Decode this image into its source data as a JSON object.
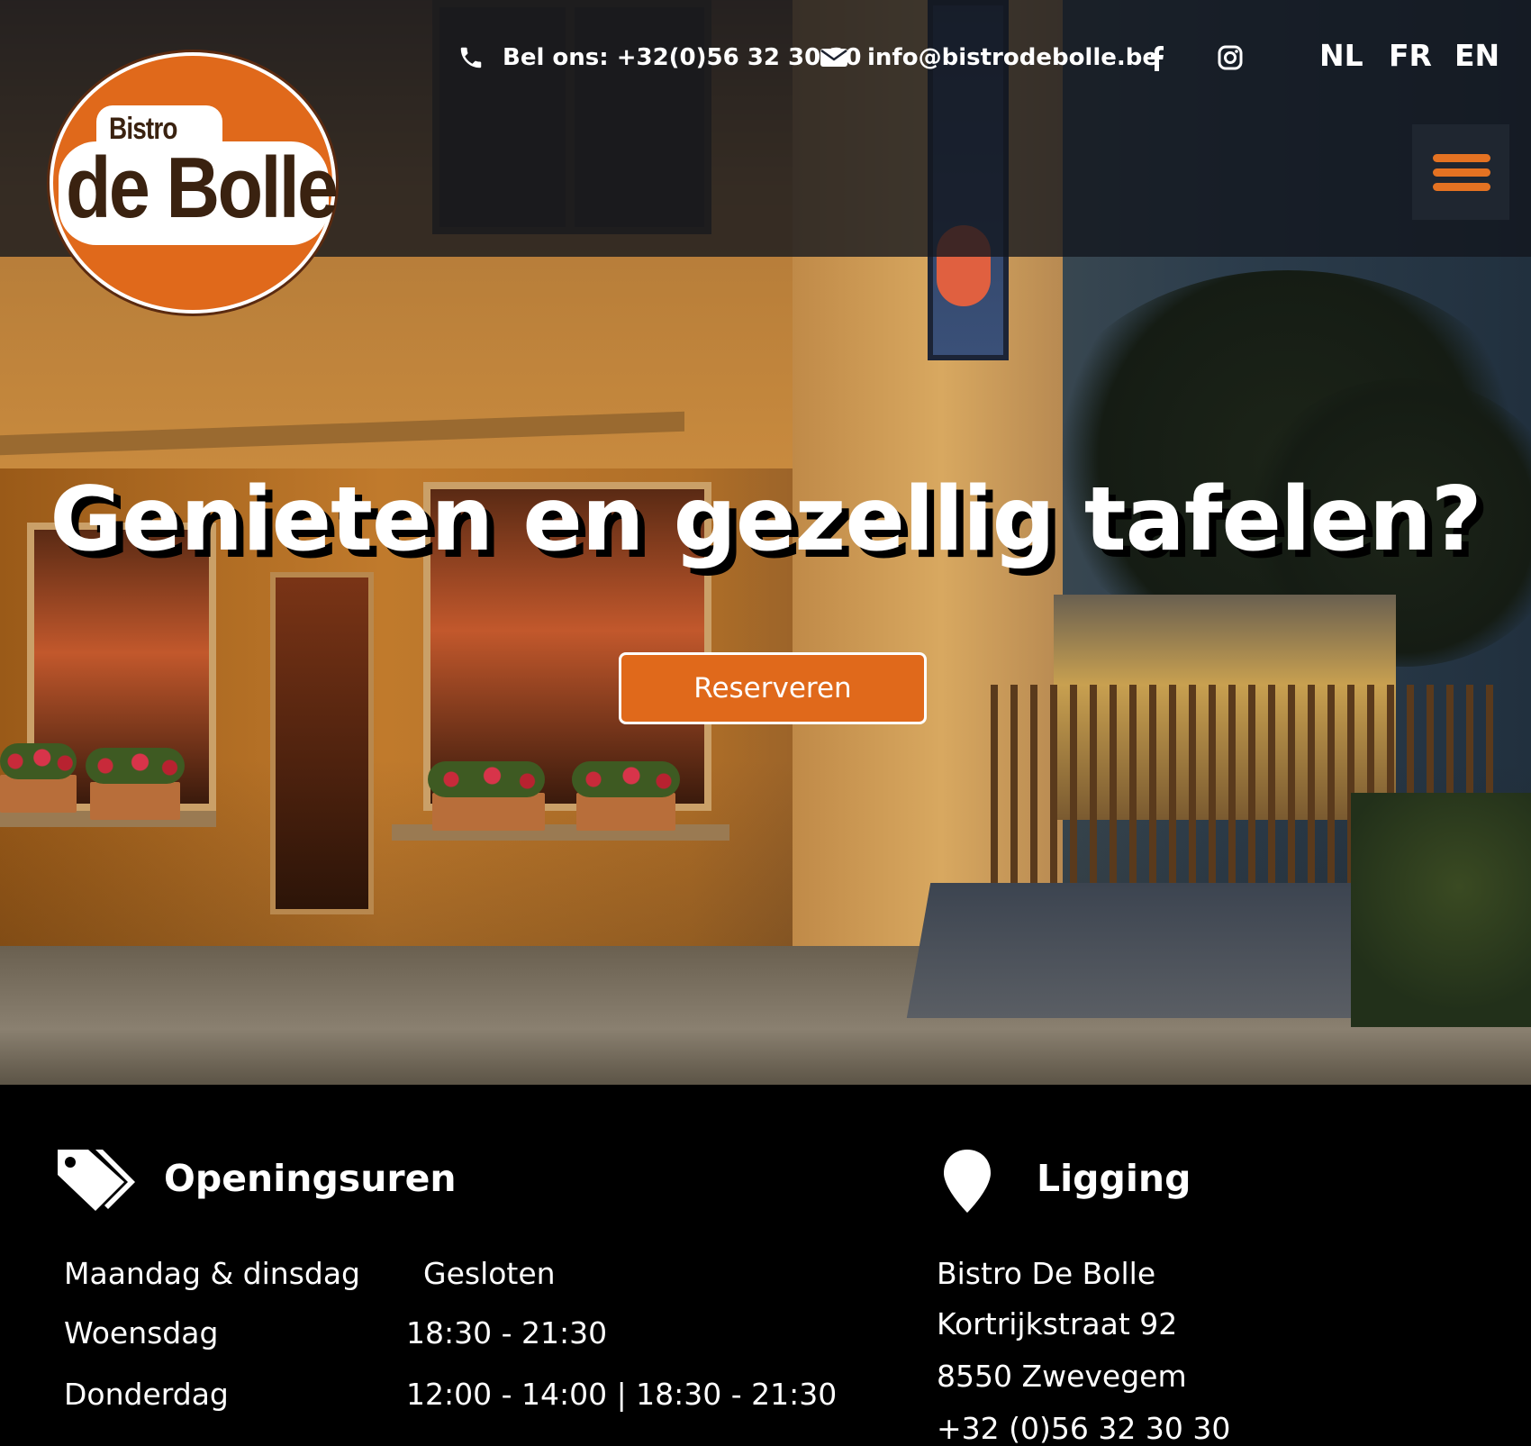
{
  "header": {
    "phone_text": "Bel ons: +32(0)56 32 30 30",
    "email_text": "info@bistrodebolle.be",
    "languages": [
      "NL",
      "FR",
      "EN"
    ],
    "logo": {
      "top_word": "Bistro",
      "name": "de Bolle"
    },
    "icons": [
      "phone-icon",
      "envelope-icon",
      "facebook-icon",
      "instagram-icon",
      "hamburger-menu-icon"
    ],
    "accent_color": "#e0691b"
  },
  "hero": {
    "headline": "Genieten en gezellig tafelen?",
    "cta_label": "Reserveren"
  },
  "hours": {
    "title": "Openingsuren",
    "icon": "tags-icon",
    "rows": [
      {
        "day": "Maandag & dinsdag",
        "time": "Gesloten"
      },
      {
        "day": "Woensdag",
        "time": "18:30 - 21:30"
      },
      {
        "day": "Donderdag",
        "time": "12:00 - 14:00 | 18:30 - 21:30"
      }
    ]
  },
  "location": {
    "title": "Ligging",
    "icon": "map-pin-icon",
    "lines": [
      "Bistro De Bolle",
      "Kortrijkstraat 92",
      "8550 Zwevegem",
      "+32 (0)56 32 30 30"
    ]
  }
}
